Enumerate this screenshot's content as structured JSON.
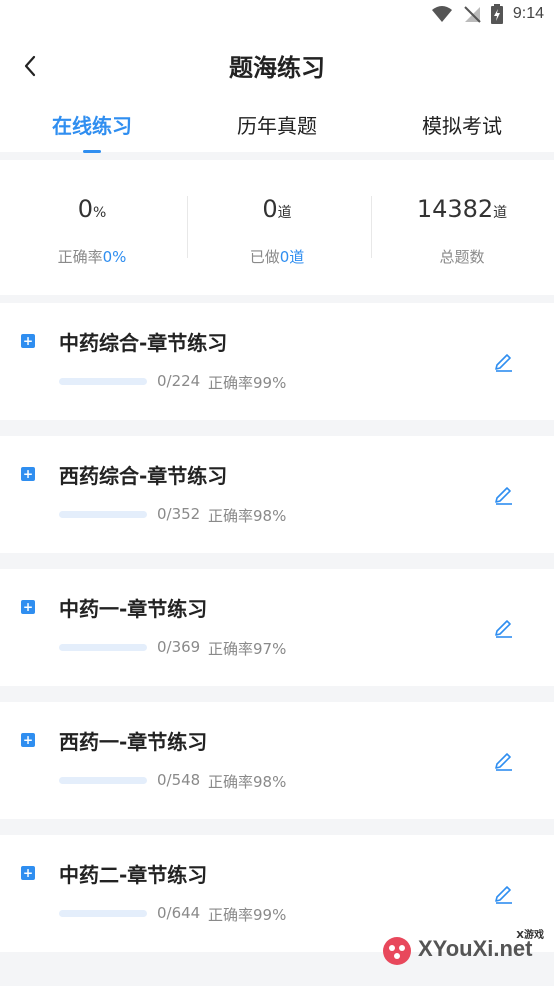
{
  "status_bar": {
    "time": "9:14"
  },
  "header": {
    "title": "题海练习"
  },
  "tabs": [
    {
      "label": "在线练习",
      "active": true
    },
    {
      "label": "历年真题",
      "active": false
    },
    {
      "label": "模拟考试",
      "active": false
    }
  ],
  "stats": [
    {
      "value": "0",
      "unit": "%",
      "label": "正确率",
      "label_value": "0%"
    },
    {
      "value": "0",
      "unit": "道",
      "label": "已做",
      "label_value": "0道"
    },
    {
      "value": "14382",
      "unit": "道",
      "label": "总题数",
      "label_value": ""
    }
  ],
  "cards": [
    {
      "title": "中药综合-章节练习",
      "progress_text": "0/224",
      "progress_fraction": 0,
      "accuracy": "正确率99%"
    },
    {
      "title": "西药综合-章节练习",
      "progress_text": "0/352",
      "progress_fraction": 0,
      "accuracy": "正确率98%"
    },
    {
      "title": "中药一-章节练习",
      "progress_text": "0/369",
      "progress_fraction": 0,
      "accuracy": "正确率97%"
    },
    {
      "title": "西药一-章节练习",
      "progress_text": "0/548",
      "progress_fraction": 0,
      "accuracy": "正确率98%"
    },
    {
      "title": "中药二-章节练习",
      "progress_text": "0/644",
      "progress_fraction": 0,
      "accuracy": "正确率99%"
    }
  ],
  "watermark": {
    "text": "XYouXi.net",
    "small": "X游戏"
  },
  "colors": {
    "accent": "#2f8ef0",
    "muted": "#8a8a8a",
    "background": "#f4f5f7"
  },
  "icons": {
    "back": "chevron-left-icon",
    "card": "plus-bookmark-icon",
    "edit": "pencil-icon"
  }
}
